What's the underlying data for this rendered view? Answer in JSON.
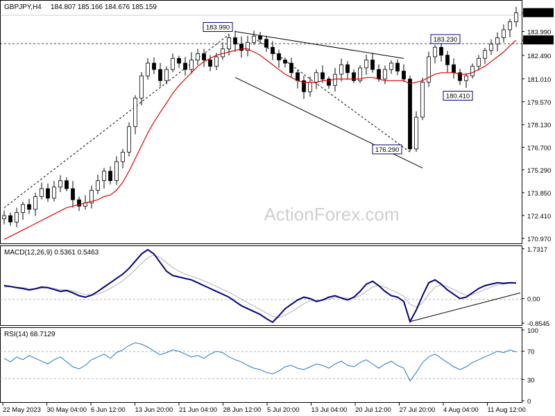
{
  "header": {
    "symbol": "GBPJPY,H4",
    "ohlc": "184.807 185.166 184.676 185.159"
  },
  "watermark": "ActionForex.com",
  "colors": {
    "candle": "#000000",
    "ma": "#e00000",
    "macd": "#00007a",
    "signal": "#b0b0b0",
    "rsi": "#1e78c8",
    "trendline": "#000000",
    "price_tag_bg": "#000000",
    "price_tag_fg": "#ffffff",
    "annotation_border": "#00007a",
    "annotation_text": "#00007a"
  },
  "chart_data": [
    {
      "type": "candlestick",
      "panel": "price",
      "y_ticks": [
        "185.159",
        "183.990",
        "183.440",
        "182.490",
        "181.010",
        "179.570",
        "178.130",
        "176.700",
        "175.290",
        "173.850",
        "172.410",
        "170.970"
      ],
      "ylim": [
        170.7,
        185.8
      ],
      "current_price": "185.159",
      "reference_level": "183.440",
      "annotations": [
        {
          "text": "183.990",
          "value": 183.99
        },
        {
          "text": "183.230",
          "value": 183.23
        },
        {
          "text": "180.410",
          "value": 180.41
        },
        {
          "text": "176.290",
          "value": 176.29
        }
      ],
      "close_series": [
        172.4,
        172.0,
        172.6,
        173.1,
        172.8,
        173.6,
        174.1,
        173.5,
        174.2,
        174.6,
        174.1,
        173.4,
        173.0,
        173.2,
        174.0,
        174.6,
        175.2,
        174.6,
        175.8,
        176.4,
        178.0,
        179.8,
        181.2,
        182.0,
        181.6,
        180.9,
        181.6,
        182.3,
        182.0,
        181.6,
        182.2,
        182.6,
        182.2,
        181.8,
        182.4,
        182.9,
        183.6,
        183.2,
        182.8,
        183.3,
        183.7,
        183.5,
        183.0,
        182.6,
        182.2,
        182.0,
        181.4,
        180.9,
        180.2,
        180.8,
        181.4,
        181.0,
        180.6,
        181.3,
        181.9,
        181.4,
        180.9,
        181.7,
        182.2,
        181.6,
        181.0,
        181.6,
        182.0,
        181.5,
        181.0,
        176.6,
        178.6,
        180.8,
        182.4,
        183.0,
        182.5,
        181.9,
        181.4,
        180.9,
        181.2,
        181.8,
        182.3,
        182.8,
        183.2,
        183.6,
        184.1,
        184.6,
        185.16
      ],
      "ma_series": [
        170.9,
        171.1,
        171.3,
        171.5,
        171.7,
        171.9,
        172.1,
        172.3,
        172.5,
        172.7,
        172.9,
        173.0,
        173.1,
        173.2,
        173.3,
        173.4,
        173.6,
        173.7,
        174.0,
        174.5,
        175.2,
        176.0,
        176.8,
        177.6,
        178.3,
        178.9,
        179.5,
        180.1,
        180.6,
        181.0,
        181.4,
        181.8,
        182.1,
        182.3,
        182.5,
        182.6,
        182.7,
        182.8,
        182.9,
        182.9,
        182.7,
        182.5,
        182.2,
        181.9,
        181.6,
        181.3,
        181.1,
        180.9,
        180.8,
        180.8,
        180.8,
        180.9,
        180.9,
        181.0,
        181.0,
        181.0,
        181.0,
        181.0,
        181.1,
        181.1,
        181.0,
        180.9,
        180.9,
        180.9,
        180.9,
        180.7,
        180.8,
        180.9,
        181.1,
        181.3,
        181.4,
        181.4,
        181.4,
        181.3,
        181.3,
        181.4,
        181.6,
        181.8,
        182.1,
        182.4,
        182.7,
        183.1,
        183.44
      ]
    },
    {
      "type": "line",
      "panel": "macd",
      "title": "MACD(12,26,9) 0.5361 0.5463",
      "y_ticks": [
        "1.7317",
        "0.00",
        "-0.8545"
      ],
      "ylim": [
        -0.9,
        1.75
      ],
      "series": [
        {
          "role": "macd",
          "values": [
            0.45,
            0.42,
            0.38,
            0.35,
            0.3,
            0.34,
            0.4,
            0.38,
            0.32,
            0.25,
            0.28,
            0.2,
            0.1,
            0.05,
            0.12,
            0.25,
            0.4,
            0.55,
            0.7,
            0.85,
            1.05,
            1.3,
            1.55,
            1.7,
            1.55,
            1.25,
            0.95,
            0.8,
            0.75,
            0.7,
            0.65,
            0.55,
            0.45,
            0.35,
            0.25,
            0.15,
            0.05,
            -0.1,
            -0.25,
            -0.35,
            -0.45,
            -0.55,
            -0.7,
            -0.82,
            -0.6,
            -0.35,
            -0.2,
            -0.05,
            0.05,
            0.0,
            -0.1,
            -0.05,
            0.05,
            0.1,
            0.02,
            -0.05,
            0.05,
            0.25,
            0.5,
            0.6,
            0.45,
            0.25,
            0.1,
            0.05,
            -0.1,
            -0.8,
            -0.4,
            0.1,
            0.55,
            0.65,
            0.5,
            0.3,
            0.15,
            0.0,
            0.05,
            0.2,
            0.35,
            0.45,
            0.5,
            0.55,
            0.53,
            0.55,
            0.54
          ]
        },
        {
          "role": "signal",
          "values": [
            0.4,
            0.42,
            0.4,
            0.38,
            0.35,
            0.34,
            0.36,
            0.37,
            0.35,
            0.31,
            0.3,
            0.26,
            0.2,
            0.14,
            0.12,
            0.16,
            0.24,
            0.35,
            0.48,
            0.62,
            0.8,
            1.0,
            1.22,
            1.42,
            1.52,
            1.42,
            1.25,
            1.08,
            0.95,
            0.85,
            0.78,
            0.7,
            0.62,
            0.52,
            0.42,
            0.32,
            0.22,
            0.1,
            -0.02,
            -0.14,
            -0.26,
            -0.38,
            -0.5,
            -0.62,
            -0.66,
            -0.58,
            -0.46,
            -0.32,
            -0.18,
            -0.08,
            -0.06,
            -0.06,
            -0.02,
            0.04,
            0.04,
            0.01,
            0.02,
            0.1,
            0.25,
            0.4,
            0.45,
            0.4,
            0.3,
            0.2,
            0.08,
            -0.2,
            -0.3,
            -0.15,
            0.15,
            0.4,
            0.48,
            0.42,
            0.32,
            0.2,
            0.12,
            0.14,
            0.22,
            0.32,
            0.4,
            0.47,
            0.5,
            0.53,
            0.55
          ]
        }
      ],
      "trendline": true
    },
    {
      "type": "line",
      "panel": "rsi",
      "title": "RSI(14) 68.7129",
      "y_ticks": [
        "100",
        "70",
        "30",
        "0"
      ],
      "ylim": [
        0,
        100
      ],
      "levels": [
        70,
        30
      ],
      "series": [
        {
          "role": "rsi",
          "values": [
            60,
            55,
            62,
            58,
            64,
            60,
            56,
            52,
            58,
            62,
            55,
            48,
            45,
            50,
            58,
            62,
            66,
            60,
            68,
            72,
            78,
            82,
            80,
            76,
            70,
            65,
            68,
            72,
            70,
            66,
            62,
            64,
            60,
            66,
            70,
            68,
            62,
            58,
            55,
            50,
            46,
            44,
            40,
            38,
            42,
            48,
            50,
            46,
            44,
            48,
            52,
            50,
            46,
            52,
            56,
            50,
            48,
            54,
            58,
            52,
            46,
            52,
            56,
            50,
            46,
            28,
            40,
            54,
            62,
            66,
            60,
            54,
            48,
            44,
            48,
            54,
            58,
            62,
            66,
            70,
            68,
            72,
            69
          ]
        }
      ]
    }
  ],
  "x_axis": {
    "labels": [
      "22 May 2023",
      "30 May 04:00",
      "6 Jun 12:00",
      "13 Jun 20:00",
      "21 Jun 04:00",
      "28 Jun 12:00",
      "5 Jul 20:00",
      "13 Jul 04:00",
      "20 Jul 12:00",
      "27 Jul 20:00",
      "4 Aug 04:00",
      "11 Aug 12:00"
    ]
  }
}
